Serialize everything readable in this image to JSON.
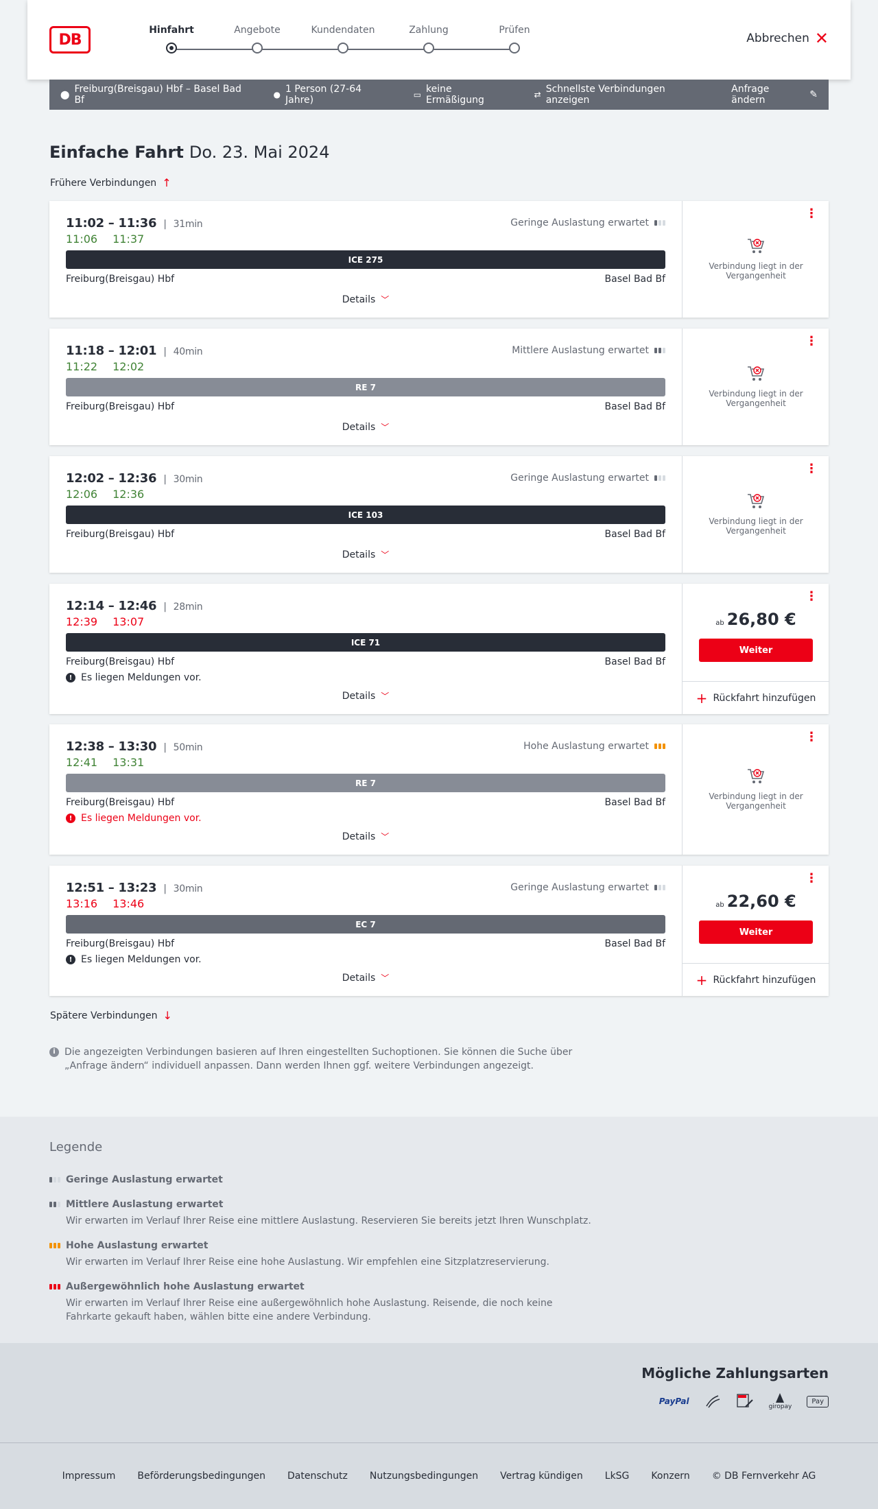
{
  "header": {
    "logo": "DB",
    "steps": [
      "Hinfahrt",
      "Angebote",
      "Kundendaten",
      "Zahlung",
      "Prüfen"
    ],
    "cancel_label": "Abbrechen"
  },
  "filters": {
    "route": "Freiburg(Breisgau) Hbf – Basel Bad Bf",
    "passengers": "1 Person (27-64 Jahre)",
    "discount": "keine Ermäßigung",
    "fastest": "Schnellste Verbindungen anzeigen",
    "edit": "Anfrage ändern"
  },
  "title": {
    "trip_type": "Einfache Fahrt",
    "date": "Do. 23. Mai 2024"
  },
  "earlier_label": "Frühere Verbindungen",
  "later_label": "Spätere Verbindungen",
  "details_label": "Details",
  "past_label": "Verbindung liegt in der Vergangenheit",
  "weiter_label": "Weiter",
  "return_label": "Rückfahrt hinzufügen",
  "price_prefix": "ab",
  "connections": [
    {
      "times": "11:02 – 11:36",
      "duration": "31min",
      "rt_dep": "11:06",
      "rt_arr": "11:37",
      "rt_status": "ontime",
      "load": "Geringe Auslastung erwartet",
      "load_level": "low",
      "train": "ICE 275",
      "train_type": "ice",
      "from": "Freiburg(Breisgau) Hbf",
      "to": "Basel Bad Bf",
      "message": "",
      "price": ""
    },
    {
      "times": "11:18 – 12:01",
      "duration": "40min",
      "rt_dep": "11:22",
      "rt_arr": "12:02",
      "rt_status": "ontime",
      "load": "Mittlere Auslastung erwartet",
      "load_level": "mid",
      "train": "RE 7",
      "train_type": "re",
      "from": "Freiburg(Breisgau) Hbf",
      "to": "Basel Bad Bf",
      "message": "",
      "price": ""
    },
    {
      "times": "12:02 – 12:36",
      "duration": "30min",
      "rt_dep": "12:06",
      "rt_arr": "12:36",
      "rt_status": "ontime",
      "load": "Geringe Auslastung erwartet",
      "load_level": "low",
      "train": "ICE 103",
      "train_type": "ice",
      "from": "Freiburg(Breisgau) Hbf",
      "to": "Basel Bad Bf",
      "message": "",
      "price": ""
    },
    {
      "times": "12:14 – 12:46",
      "duration": "28min",
      "rt_dep": "12:39",
      "rt_arr": "13:07",
      "rt_status": "delay",
      "load": "",
      "load_level": "",
      "train": "ICE 71",
      "train_type": "ice",
      "from": "Freiburg(Breisgau) Hbf",
      "to": "Basel Bad Bf",
      "message": "Es liegen Meldungen vor.",
      "message_level": "info",
      "price": "26,80 €"
    },
    {
      "times": "12:38 – 13:30",
      "duration": "50min",
      "rt_dep": "12:41",
      "rt_arr": "13:31",
      "rt_status": "ontime",
      "load": "Hohe Auslastung erwartet",
      "load_level": "high",
      "train": "RE 7",
      "train_type": "re",
      "from": "Freiburg(Breisgau) Hbf",
      "to": "Basel Bad Bf",
      "message": "Es liegen Meldungen vor.",
      "message_level": "red",
      "price": ""
    },
    {
      "times": "12:51 – 13:23",
      "duration": "30min",
      "rt_dep": "13:16",
      "rt_arr": "13:46",
      "rt_status": "delay",
      "load": "Geringe Auslastung erwartet",
      "load_level": "low",
      "train": "EC 7",
      "train_type": "ec",
      "from": "Freiburg(Breisgau) Hbf",
      "to": "Basel Bad Bf",
      "message": "Es liegen Meldungen vor.",
      "message_level": "info",
      "price": "22,60 €"
    }
  ],
  "info_text": "Die angezeigten Verbindungen basieren auf Ihren eingestellten Suchoptionen. Sie können die Suche über „Anfrage ändern“ individuell anpassen. Dann werden Ihnen ggf. weitere Verbindungen angezeigt.",
  "legend": {
    "title": "Legende",
    "items": [
      {
        "title": "Geringe Auslastung erwartet",
        "desc": "",
        "level": "low"
      },
      {
        "title": "Mittlere Auslastung erwartet",
        "desc": "Wir erwarten im Verlauf Ihrer Reise eine mittlere Auslastung. Reservieren Sie bereits jetzt Ihren Wunschplatz.",
        "level": "mid"
      },
      {
        "title": "Hohe Auslastung erwartet",
        "desc": "Wir erwarten im Verlauf Ihrer Reise eine hohe Auslastung. Wir empfehlen eine Sitzplatzreservierung.",
        "level": "high"
      },
      {
        "title": "Außergewöhnlich hohe Auslastung erwartet",
        "desc": "Wir erwarten im Verlauf Ihrer Reise eine außergewöhnlich hohe Auslastung. Reisende, die noch keine Fahrkarte gekauft haben, wählen bitte eine andere Verbindung.",
        "level": "xhigh"
      }
    ]
  },
  "payment": {
    "title": "Mögliche Zahlungsarten",
    "methods": [
      "PayPal",
      "giropay",
      "Pay"
    ]
  },
  "footer": [
    "Impressum",
    "Beförderungsbedingungen",
    "Datenschutz",
    "Nutzungsbedingungen",
    "Vertrag kündigen",
    "LkSG",
    "Konzern",
    "© DB Fernverkehr AG"
  ],
  "colors": {
    "brand_red": "#ec0016",
    "ontime_green": "#408335",
    "dark": "#282d37",
    "grey": "#646973",
    "load_high": "#f39200"
  }
}
